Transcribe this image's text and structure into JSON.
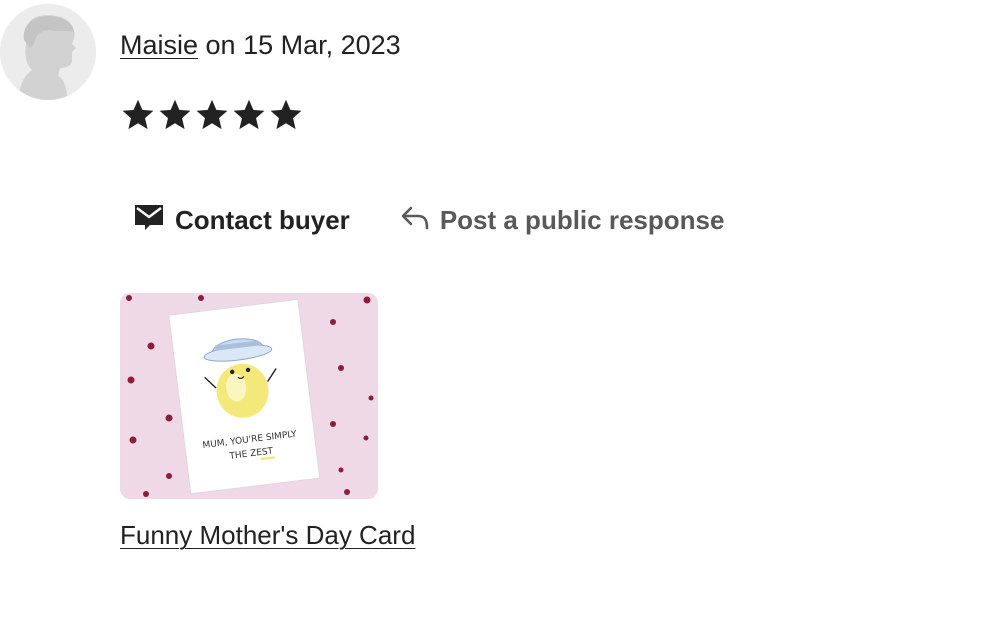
{
  "review": {
    "reviewer_name": "Maisie",
    "date_text": " on 15 Mar, 2023",
    "rating": 5,
    "rating_max": 5
  },
  "actions": {
    "contact_label": "Contact buyer",
    "response_label": "Post a public response"
  },
  "listing": {
    "title": "Funny Mother's Day Card",
    "card_text_line1": "MUM, YOU'RE SIMPLY",
    "card_text_line2": "THE ZEST"
  },
  "colors": {
    "text": "#222222",
    "muted": "#595959",
    "thumb_background": "#f0d9e6",
    "heart": "#8c1d3c"
  },
  "icons": {
    "avatar": "default-user-avatar",
    "star": "star-filled",
    "contact": "envelope-message-icon",
    "response": "reply-arrow-icon"
  }
}
